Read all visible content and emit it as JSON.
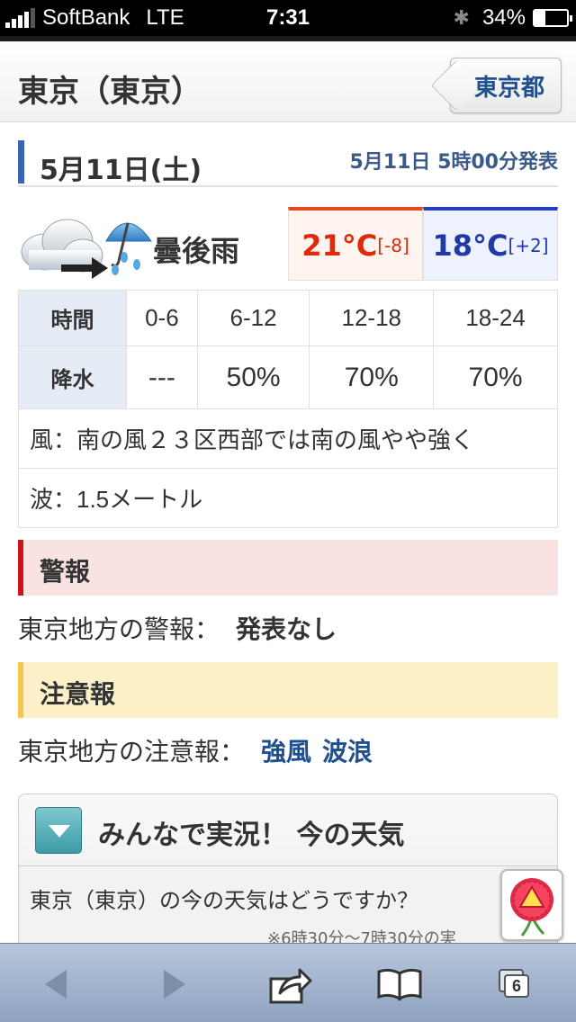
{
  "status_bar": {
    "carrier": "SoftBank",
    "network": "LTE",
    "time": "7:31",
    "battery_percent": "34%",
    "battery_level": 0.34
  },
  "header": {
    "title": "東京（東京）",
    "back_button_label": "東京都"
  },
  "date_row": {
    "date": "5月11日(土)",
    "issued": "5月11日 5時00分発表"
  },
  "forecast": {
    "icon": "cloud-then-rain-icon",
    "weather_text": "曇後雨",
    "high_temp": "21°C",
    "high_diff": "[-8]",
    "low_temp": "18°C",
    "low_diff": "[+2]",
    "high_color": "#e0280a",
    "low_color": "#1f3aa8"
  },
  "precip_table": {
    "time_label": "時間",
    "precip_label": "降水",
    "periods": [
      "0-6",
      "6-12",
      "12-18",
      "18-24"
    ],
    "values": [
      "---",
      "50%",
      "70%",
      "70%"
    ],
    "wind": "風：南の風２３区西部では南の風やや強く",
    "waves": "波：1.5メートル"
  },
  "warnings": {
    "heading": "警報",
    "label": "東京地方の警報：",
    "value": "発表なし"
  },
  "advisories": {
    "heading": "注意報",
    "label": "東京地方の注意報：",
    "items": [
      "強風",
      "波浪"
    ]
  },
  "live": {
    "heading": "みんなで実況！ 今の天気",
    "question": "東京（東京）の今の天気はどうですか？",
    "note": "※6時30分〜7時30分の実"
  },
  "toolbar": {
    "tab_count": "6"
  }
}
